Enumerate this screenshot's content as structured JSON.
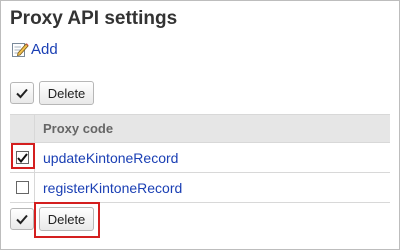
{
  "page": {
    "title": "Proxy API settings"
  },
  "actions": {
    "add_label": "Add"
  },
  "toolbar_top": {
    "delete_label": "Delete"
  },
  "table": {
    "header": "Proxy code",
    "rows": [
      {
        "code": "updateKintoneRecord",
        "checked": true
      },
      {
        "code": "registerKintoneRecord",
        "checked": false
      }
    ]
  },
  "toolbar_bottom": {
    "delete_label": "Delete"
  },
  "colors": {
    "link": "#1a3fb4",
    "highlight": "#d41f1f",
    "header_bg": "#e6e6e6"
  }
}
